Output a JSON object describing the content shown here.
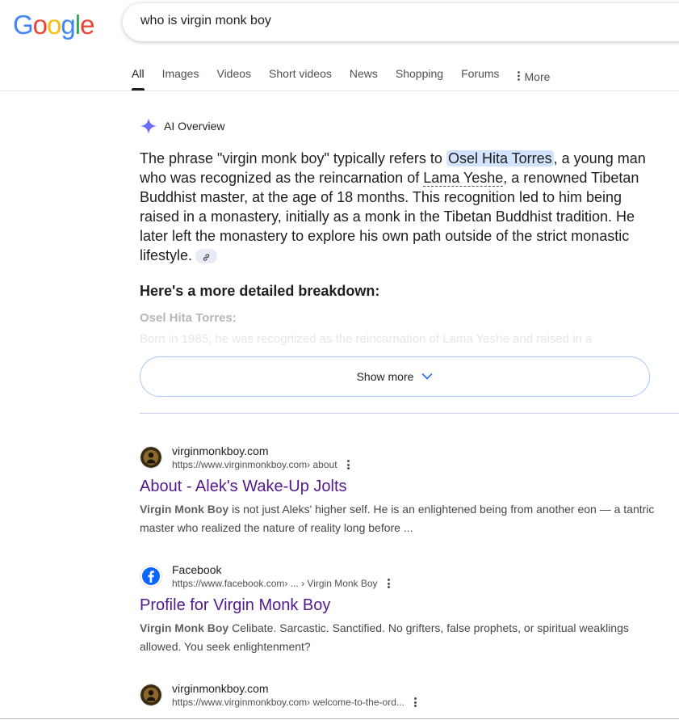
{
  "logo": {
    "letters": [
      "G",
      "o",
      "o",
      "g",
      "l",
      "e"
    ],
    "colors": [
      "#4285F4",
      "#EA4335",
      "#FBBC05",
      "#4285F4",
      "#34A853",
      "#EA4335"
    ]
  },
  "search": {
    "query": "who is virgin monk boy"
  },
  "tabs": [
    {
      "label": "All"
    },
    {
      "label": "Images"
    },
    {
      "label": "Videos"
    },
    {
      "label": "Short videos"
    },
    {
      "label": "News"
    },
    {
      "label": "Shopping"
    },
    {
      "label": "Forums"
    },
    {
      "label": "More"
    }
  ],
  "ai_overview": {
    "label": "AI Overview",
    "p_part1": "The phrase \"virgin monk boy\" typically refers to ",
    "highlight": "Osel Hita Torres",
    "p_part2": ", a young man who was recognized as the reincarnation of ",
    "link_name": "Lama Yeshe",
    "p_part3": ", a renowned Tibetan Buddhist master, at the age of 18 months. This recognition led to him being raised in a monastery, initially as a monk in the Tibetan Buddhist tradition. He later left the monastery to explore his own path outside of the strict monastic lifestyle.",
    "breakdown_heading": "Here's a more detailed breakdown:",
    "subheading": "Osel Hita Torres:",
    "faded_line": "Born in 1985, he was recognized as the reincarnation of Lama Yeshe and raised in a",
    "show_more": "Show more",
    "accent": "#a8c7fa"
  },
  "results": [
    {
      "site": "virginmonkboy.com",
      "url": "https://www.virginmonkboy.com",
      "path": " › about",
      "title": "About - Alek's Wake-Up Jolts",
      "snippet_bold": "Virgin Monk Boy",
      "snippet_rest": " is not just Aleks' higher self. He is an enlightened being from another eon — a tantric master who realized the nature of reality long before ..."
    },
    {
      "site": "Facebook",
      "url": "https://www.facebook.com",
      "path": " › ... › Virgin Monk Boy",
      "title": "Profile for Virgin Monk Boy",
      "snippet_bold": "Virgin Monk Boy",
      "snippet_rest": " Celibate. Sarcastic. Sanctified. No grifters, false prophets, or spiritual weaklings allowed. You seek enlightenment?"
    },
    {
      "site": "virginmonkboy.com",
      "url": "https://www.virginmonkboy.com",
      "path": " › welcome-to-the-ord...",
      "title": "",
      "snippet_bold": "",
      "snippet_rest": ""
    }
  ]
}
